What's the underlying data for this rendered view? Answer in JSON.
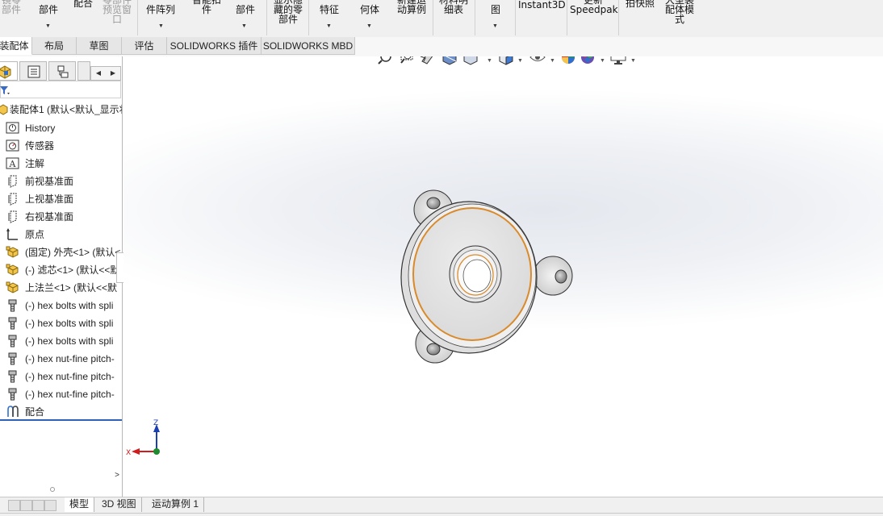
{
  "ribbon": {
    "buttons": [
      {
        "label": "镜零\n部件",
        "dim": true
      },
      {
        "label": "\n部件",
        "dim": false
      },
      {
        "label": "配合",
        "dim": false
      },
      {
        "label": "零部件\n预览窗\n口",
        "dim": true
      },
      {
        "label": "件阵列",
        "dim": false
      },
      {
        "label": "智能扣\n件",
        "dim": false
      },
      {
        "label": "部件",
        "dim": false
      },
      {
        "label": "显示隐\n藏的零\n部件",
        "dim": false
      },
      {
        "label": "特征",
        "dim": false
      },
      {
        "label": "何体",
        "dim": false
      },
      {
        "label": "新建运\n动算例",
        "dim": false
      },
      {
        "label": "材料明\n细表",
        "dim": false
      },
      {
        "label": "图",
        "dim": false
      },
      {
        "label": "Instant3D",
        "dim": false
      },
      {
        "label": "更新\nSpeedpak",
        "dim": false
      },
      {
        "label": "拍快照",
        "dim": false
      },
      {
        "label": "大型装\n配体模\n式",
        "dim": false
      }
    ]
  },
  "tabs": [
    {
      "label": "装配体",
      "active": true
    },
    {
      "label": "布局",
      "active": false
    },
    {
      "label": "草图",
      "active": false
    },
    {
      "label": "评估",
      "active": false
    },
    {
      "label": "SOLIDWORKS 插件",
      "active": false
    },
    {
      "label": "SOLIDWORKS MBD",
      "active": false
    }
  ],
  "tree": {
    "root": "装配体1 (默认<默认_显示状",
    "items": [
      {
        "label": "History",
        "icon": "history-icon"
      },
      {
        "label": "传感器",
        "icon": "sensor-icon"
      },
      {
        "label": "注解",
        "icon": "annotation-icon"
      },
      {
        "label": "前视基准面",
        "icon": "plane-icon"
      },
      {
        "label": "上视基准面",
        "icon": "plane-icon"
      },
      {
        "label": "右视基准面",
        "icon": "plane-icon"
      },
      {
        "label": "原点",
        "icon": "origin-icon"
      },
      {
        "label": "(固定) 外壳<1> (默认<",
        "icon": "part-icon"
      },
      {
        "label": "(-) 滤芯<1> (默认<<默",
        "icon": "part-icon"
      },
      {
        "label": "上法兰<1> (默认<<默",
        "icon": "part-icon"
      },
      {
        "label": "(-) hex bolts with spli",
        "icon": "bolt-icon"
      },
      {
        "label": "(-) hex bolts with spli",
        "icon": "bolt-icon"
      },
      {
        "label": "(-) hex bolts with spli",
        "icon": "bolt-icon"
      },
      {
        "label": "(-) hex nut-fine pitch-",
        "icon": "bolt-icon"
      },
      {
        "label": "(-) hex nut-fine pitch-",
        "icon": "bolt-icon"
      },
      {
        "label": "(-) hex nut-fine pitch-",
        "icon": "bolt-icon"
      },
      {
        "label": "配合",
        "icon": "mates-icon"
      }
    ]
  },
  "triad": {
    "x_label": "X",
    "z_label": "Z"
  },
  "bottom_tabs": [
    {
      "label": "模型",
      "active": true
    },
    {
      "label": "3D 视图",
      "active": false
    },
    {
      "label": "运动算例 1",
      "active": false
    }
  ],
  "colors": {
    "accent_orange": "#d98a2b",
    "tree_selection_line": "#2e62b9",
    "triad_x": "#d01c1c",
    "triad_z": "#1b3fae",
    "triad_y": "#1f8a2e"
  }
}
